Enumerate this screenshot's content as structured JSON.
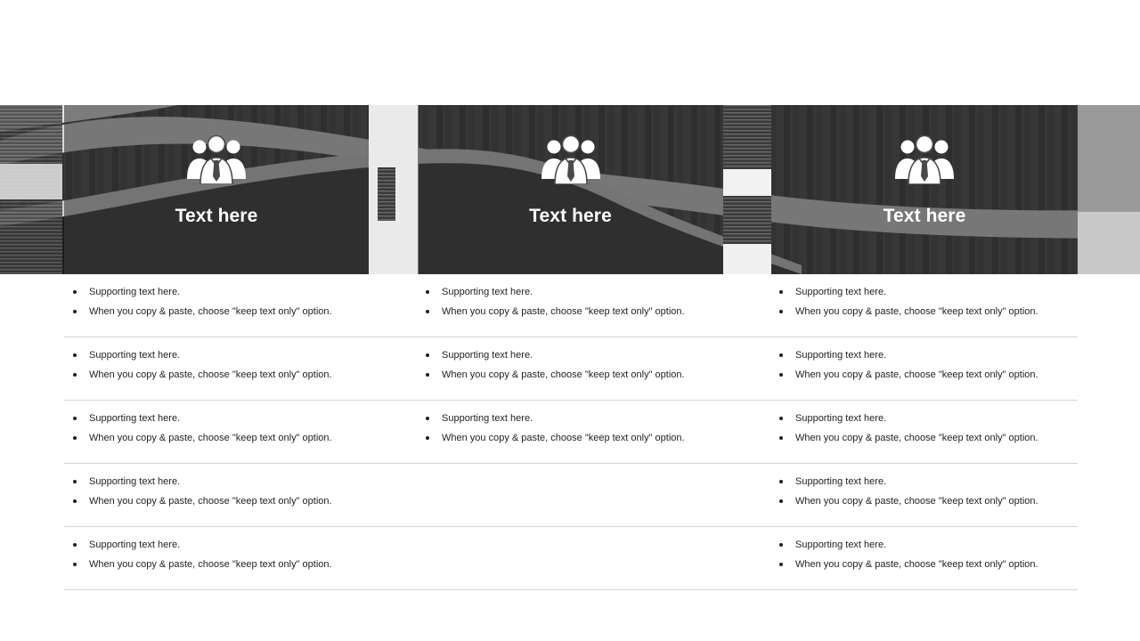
{
  "panels": [
    {
      "icon": "people-group-icon",
      "title": "Text here"
    },
    {
      "icon": "people-group-icon",
      "title": "Text here"
    },
    {
      "icon": "people-group-icon",
      "title": "Text here"
    }
  ],
  "rows": [
    {
      "cells": [
        {
          "lines": [
            "Supporting text here.",
            "When you copy & paste, choose \"keep text only\" option."
          ]
        },
        {
          "lines": [
            "Supporting text here.",
            "When you copy & paste, choose \"keep text only\" option."
          ]
        },
        {
          "lines": [
            "Supporting text here.",
            "When you copy & paste, choose \"keep text only\" option."
          ]
        }
      ]
    },
    {
      "cells": [
        {
          "lines": [
            "Supporting text here.",
            "When you copy & paste, choose \"keep text only\" option."
          ]
        },
        {
          "lines": [
            "Supporting text here.",
            "When you copy & paste, choose \"keep text only\" option."
          ]
        },
        {
          "lines": [
            "Supporting text here.",
            "When you copy & paste, choose \"keep text only\" option."
          ]
        }
      ]
    },
    {
      "cells": [
        {
          "lines": [
            "Supporting text here.",
            "When you copy & paste, choose \"keep text only\" option."
          ]
        },
        {
          "lines": [
            "Supporting text here.",
            "When you copy & paste, choose \"keep text only\" option."
          ]
        },
        {
          "lines": [
            "Supporting text here.",
            "When you copy & paste, choose \"keep text only\" option."
          ]
        }
      ]
    },
    {
      "cells": [
        {
          "lines": [
            "Supporting text here.",
            "When you copy & paste, choose \"keep text only\" option."
          ]
        },
        {
          "lines": []
        },
        {
          "lines": [
            "Supporting text here.",
            "When you copy & paste, choose \"keep text only\" option."
          ]
        }
      ]
    },
    {
      "cells": [
        {
          "lines": [
            "Supporting text here.",
            "When you copy & paste, choose \"keep text only\" option."
          ]
        },
        {
          "lines": []
        },
        {
          "lines": [
            "Supporting text here.",
            "When you copy & paste, choose \"keep text only\" option."
          ]
        }
      ]
    }
  ]
}
